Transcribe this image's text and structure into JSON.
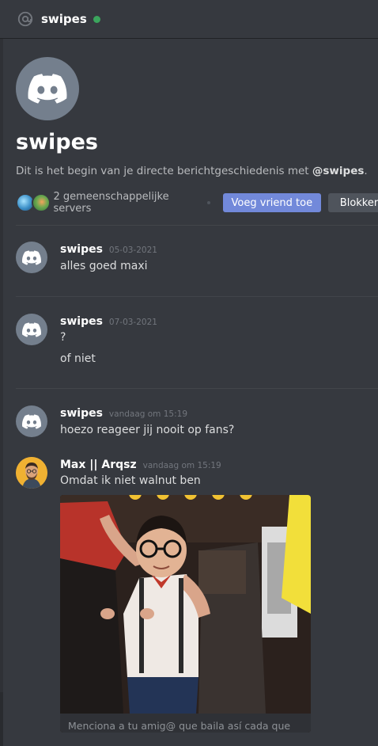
{
  "header": {
    "name": "swipes",
    "status_color": "#3ba55d"
  },
  "intro": {
    "name": "swipes",
    "text_prefix": "Dit is het begin van je directe berichtgeschiedenis met ",
    "text_mention": "@swipes",
    "text_suffix": ".",
    "mutual_servers": "2 gemeenschappelijke servers",
    "add_friend_label": "Voeg vriend toe",
    "block_label": "Blokkeren"
  },
  "messages": [
    {
      "author": "swipes",
      "timestamp": "05-03-2021",
      "lines": [
        "alles goed maxi"
      ]
    },
    {
      "author": "swipes",
      "timestamp": "07-03-2021",
      "lines": [
        "?",
        "of niet"
      ]
    },
    {
      "author": "swipes",
      "timestamp": "vandaag om 15:19",
      "lines": [
        "hoezo reageer jij nooit op fans?"
      ]
    },
    {
      "author": "Max || Arqsz",
      "timestamp": "vandaag om 15:19",
      "lines": [
        "Omdat ik niet walnut ben"
      ]
    }
  ],
  "embed": {
    "caption": "Menciona a tu amig@ que baila así cada que"
  },
  "colors": {
    "background": "#36393f",
    "accent": "#7289da",
    "default_avatar": "#747f8d"
  }
}
